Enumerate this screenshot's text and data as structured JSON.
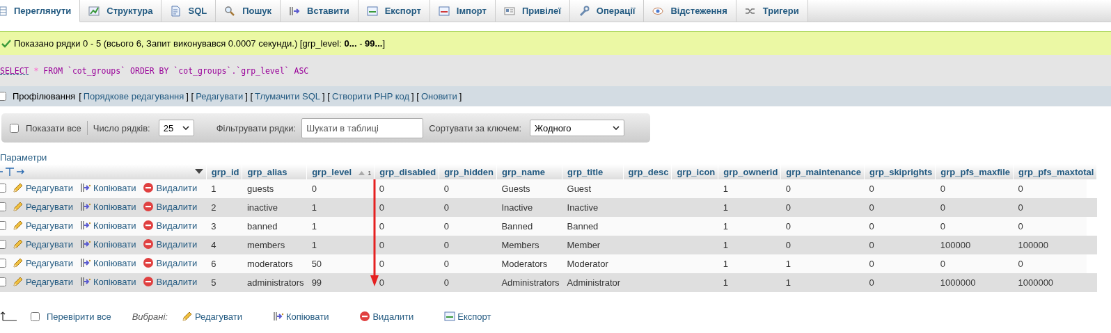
{
  "tabs": [
    {
      "label": "Переглянути",
      "selected": true
    },
    {
      "label": "Структура",
      "selected": false
    },
    {
      "label": "SQL",
      "selected": false
    },
    {
      "label": "Пошук",
      "selected": false
    },
    {
      "label": "Вставити",
      "selected": false
    },
    {
      "label": "Експорт",
      "selected": false
    },
    {
      "label": "Імпорт",
      "selected": false
    },
    {
      "label": "Привілеї",
      "selected": false
    },
    {
      "label": "Операції",
      "selected": false
    },
    {
      "label": "Відстеження",
      "selected": false
    },
    {
      "label": "Тригери",
      "selected": false
    }
  ],
  "message": "Показано рядки 0 - 5 (всього 6, Запит виконувався 0.0007 секунди.) [grp_level: **0...** - **99...**]",
  "sql": [
    {
      "kind": "keyword",
      "text": "SELECT"
    },
    {
      "kind": "operator",
      "text": "*"
    },
    {
      "kind": "keyword",
      "text": "FROM"
    },
    {
      "kind": "identifier",
      "text": "`cot_groups`"
    },
    {
      "kind": "keyword",
      "text": "ORDER BY"
    },
    {
      "kind": "identifier",
      "text": "`cot_groups`.`grp_level`"
    },
    {
      "kind": "keyword",
      "text": "ASC"
    }
  ],
  "profiling": {
    "label": "Профілювання",
    "checked": false,
    "links": [
      {
        "kind": "text",
        "text": "["
      },
      {
        "kind": "link",
        "text": "Порядкове редагування"
      },
      {
        "kind": "text",
        "text": "] ["
      },
      {
        "kind": "link",
        "text": "Редагувати"
      },
      {
        "kind": "text",
        "text": "] ["
      },
      {
        "kind": "link",
        "text": "Тлумачити SQL"
      },
      {
        "kind": "text",
        "text": "] ["
      },
      {
        "kind": "link",
        "text": "Створити PHP код"
      },
      {
        "kind": "text",
        "text": "] ["
      },
      {
        "kind": "link",
        "text": "Оновити"
      },
      {
        "kind": "text",
        "text": "]"
      }
    ]
  },
  "toolbar": {
    "show_all": {
      "label": "Показати все",
      "checked": false
    },
    "rows_label": "Число рядків:",
    "rows_value": "25",
    "filter_label": "Фільтрувати рядки:",
    "filter_placeholder": "Шукати в таблиці",
    "sort_label": "Сортувати за ключем:",
    "sort_value": "Жодного"
  },
  "options_link": "Параметри",
  "table": {
    "columns": [
      {
        "label": "grp_id",
        "sorted": false
      },
      {
        "label": "grp_alias",
        "sorted": false
      },
      {
        "label": "grp_level",
        "sorted": true,
        "sort_index": "1"
      },
      {
        "label": "grp_disabled",
        "sorted": false
      },
      {
        "label": "grp_hidden",
        "sorted": false
      },
      {
        "label": "grp_name",
        "sorted": false
      },
      {
        "label": "grp_title",
        "sorted": false
      },
      {
        "label": "grp_desc",
        "sorted": false
      },
      {
        "label": "grp_icon",
        "sorted": false
      },
      {
        "label": "grp_ownerid",
        "sorted": false
      },
      {
        "label": "grp_maintenance",
        "sorted": false
      },
      {
        "label": "grp_skiprights",
        "sorted": false
      },
      {
        "label": "grp_pfs_maxfile",
        "sorted": false
      },
      {
        "label": "grp_pfs_maxtotal",
        "sorted": false
      }
    ],
    "rows": [
      {
        "checked": false,
        "actions": [
          {
            "kind": "edit",
            "label": "Редагувати"
          },
          {
            "kind": "copy",
            "label": "Копіювати"
          },
          {
            "kind": "delete",
            "label": "Видалити"
          }
        ],
        "cells": [
          "1",
          "guests",
          "0",
          "0",
          "0",
          "Guests",
          "Guest",
          "",
          "",
          "1",
          "0",
          "0",
          "0",
          "0"
        ]
      },
      {
        "checked": false,
        "actions": [
          {
            "kind": "edit",
            "label": "Редагувати"
          },
          {
            "kind": "copy",
            "label": "Копіювати"
          },
          {
            "kind": "delete",
            "label": "Видалити"
          }
        ],
        "cells": [
          "2",
          "inactive",
          "1",
          "0",
          "0",
          "Inactive",
          "Inactive",
          "",
          "",
          "1",
          "0",
          "0",
          "0",
          "0"
        ]
      },
      {
        "checked": false,
        "actions": [
          {
            "kind": "edit",
            "label": "Редагувати"
          },
          {
            "kind": "copy",
            "label": "Копіювати"
          },
          {
            "kind": "delete",
            "label": "Видалити"
          }
        ],
        "cells": [
          "3",
          "banned",
          "1",
          "0",
          "0",
          "Banned",
          "Banned",
          "",
          "",
          "1",
          "0",
          "0",
          "0",
          "0"
        ]
      },
      {
        "checked": false,
        "actions": [
          {
            "kind": "edit",
            "label": "Редагувати"
          },
          {
            "kind": "copy",
            "label": "Копіювати"
          },
          {
            "kind": "delete",
            "label": "Видалити"
          }
        ],
        "cells": [
          "4",
          "members",
          "1",
          "0",
          "0",
          "Members",
          "Member",
          "",
          "",
          "1",
          "0",
          "0",
          "100000",
          "100000"
        ]
      },
      {
        "checked": false,
        "actions": [
          {
            "kind": "edit",
            "label": "Редагувати"
          },
          {
            "kind": "copy",
            "label": "Копіювати"
          },
          {
            "kind": "delete",
            "label": "Видалити"
          }
        ],
        "cells": [
          "6",
          "moderators",
          "50",
          "0",
          "0",
          "Moderators",
          "Moderator",
          "",
          "",
          "1",
          "1",
          "0",
          "0",
          "0"
        ]
      },
      {
        "checked": false,
        "actions": [
          {
            "kind": "edit",
            "label": "Редагувати"
          },
          {
            "kind": "copy",
            "label": "Копіювати"
          },
          {
            "kind": "delete",
            "label": "Видалити"
          }
        ],
        "cells": [
          "5",
          "administrators",
          "99",
          "0",
          "0",
          "Administrators",
          "Administrator",
          "",
          "",
          "1",
          "1",
          "0",
          "1000000",
          "1000000"
        ]
      }
    ]
  },
  "footer": {
    "check_all": {
      "label": "Перевірити все",
      "checked": false
    },
    "selected_label": "Вибрані:",
    "actions": [
      {
        "kind": "edit",
        "label": "Редагувати"
      },
      {
        "kind": "copy",
        "label": "Копіювати"
      },
      {
        "kind": "delete",
        "label": "Видалити"
      },
      {
        "kind": "export",
        "label": "Експорт"
      }
    ]
  }
}
